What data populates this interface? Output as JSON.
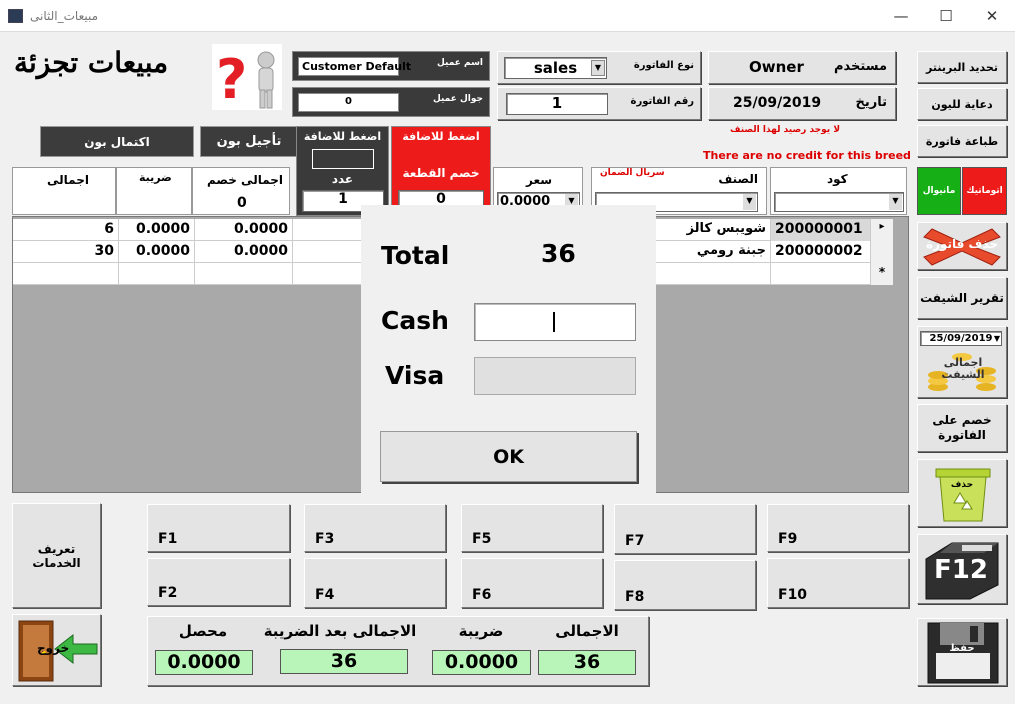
{
  "window": {
    "title": "مبيعات_الثانى",
    "minimize": "—",
    "maximize": "☐",
    "close": "✕"
  },
  "header": {
    "heading": "مبيعات تجزئة"
  },
  "customer": {
    "name_label": "اسم عميل",
    "name_value": "Customer Default",
    "mobile_label": "جوال عميل",
    "mobile_value": "0"
  },
  "invoice": {
    "type_label": "نوع الفاتورة",
    "type_value": "sales",
    "number_label": "رقم الفاتورة",
    "number_value": "1"
  },
  "user": {
    "user_label": "مستخدم",
    "user_value": "Owner",
    "date_label": "تاريخ",
    "date_value": "25/09/2019"
  },
  "messages": {
    "no_balance": "لا يوجد رصيد لهذا الصنف",
    "no_credit": "There are no credit for this breed"
  },
  "actions": {
    "complete_voucher": "اكتمال بون",
    "defer_voucher": "تأجيل بون",
    "press_add_1": "اضغط للاضافة",
    "press_add_2": "اضغط للاضافة",
    "item_discount": "خصم القطعة",
    "serial_label": "سريال الضمان"
  },
  "entry": {
    "total_label": "اجمالى",
    "tax_label": "ضريبة",
    "discount_total_label": "اجمالى خصم",
    "discount_total_value": "0",
    "count_label": "عدد",
    "count_value": "1",
    "discount_value": "0",
    "price_label": "سعر",
    "price_value": "0.0000",
    "item_label": "الصنف",
    "code_label": "كود"
  },
  "grid": {
    "rows": [
      {
        "total": "6",
        "tax": "0.0000",
        "discount": "0.0000",
        "item": "شويبس كالز",
        "code": "200000001",
        "marker": "▸"
      },
      {
        "total": "30",
        "tax": "0.0000",
        "discount": "0.0000",
        "item": "جبنة رومي",
        "code": "200000002",
        "marker": ""
      },
      {
        "total": "",
        "tax": "",
        "discount": "",
        "item": "",
        "code": "",
        "marker": "*"
      }
    ]
  },
  "dialog": {
    "total_label": "Total",
    "total_value": "36",
    "cash_label": "Cash",
    "cash_value": "",
    "visa_label": "Visa",
    "visa_value": "",
    "ok": "OK"
  },
  "fkeys": [
    "F1",
    "F2",
    "F3",
    "F4",
    "F5",
    "F6",
    "F7",
    "F8",
    "F9",
    "F10"
  ],
  "services": "تعريف الخدمات",
  "exit": "خروج",
  "summary": {
    "collected_label": "محصل",
    "collected_value": "0.0000",
    "after_tax_label": "الاجمالى بعد الضريبة",
    "after_tax_value": "36",
    "tax_label": "ضريبة",
    "tax_value": "0.0000",
    "total_label": "الاجمالى",
    "total_value": "36"
  },
  "right_panel": {
    "printer": "تحديد البرينتر",
    "label_print": "دعاية لليون",
    "invoice_print": "طباعة فاتورة",
    "auto": "اتوماتيك",
    "manual": "مانيوال",
    "delete_invoice": "حذف فاتورة",
    "shift_report": "تقرير الشيفت",
    "shift_date": "25/09/2019",
    "shift_total": "اجمالى الشيفت",
    "invoice_discount": "خصم على الفاتورة",
    "delete": "حذف",
    "f12": "F12",
    "save": "حفظ"
  }
}
